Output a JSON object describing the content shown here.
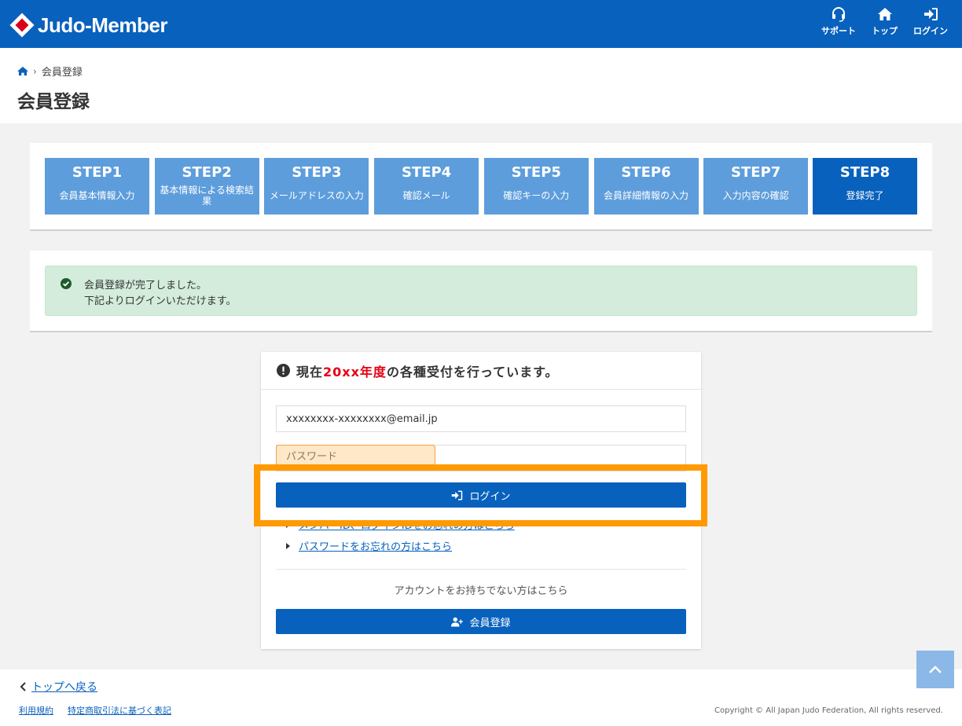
{
  "header": {
    "logo_text": "Judo-Member",
    "nav": [
      {
        "label": "サポート",
        "icon": "headset-icon"
      },
      {
        "label": "トップ",
        "icon": "home-icon"
      },
      {
        "label": "ログイン",
        "icon": "sign-in-icon"
      }
    ]
  },
  "breadcrumb": {
    "home_icon": "home-icon",
    "current": "会員登録"
  },
  "page_title": "会員登録",
  "steps": [
    {
      "num": "STEP1",
      "label": "会員基本情報入力"
    },
    {
      "num": "STEP2",
      "label": "基本情報による検索結果"
    },
    {
      "num": "STEP3",
      "label": "メールアドレスの入力"
    },
    {
      "num": "STEP4",
      "label": "確認メール"
    },
    {
      "num": "STEP5",
      "label": "確認キーの入力"
    },
    {
      "num": "STEP6",
      "label": "会員詳細情報の入力"
    },
    {
      "num": "STEP7",
      "label": "入力内容の確認"
    },
    {
      "num": "STEP8",
      "label": "登録完了"
    }
  ],
  "active_step": "STEP8",
  "success": {
    "line1": "会員登録が完了しました。",
    "line2": "下記よりログインいただけます。"
  },
  "login": {
    "notice_prefix": "現在",
    "notice_year": "20xx年度",
    "notice_suffix": "の各種受付を行っています。",
    "email_value": "xxxxxxxx-xxxxxxxx@email.jp",
    "password_placeholder": "パスワード",
    "login_button": "ログイン",
    "link_forgot_id": "メンバーID、ログインIDをお忘れの方はこちら",
    "link_forgot_password": "パスワードをお忘れの方はこちら",
    "no_account_text": "アカウントをお持ちでない方はこちら",
    "register_button": "会員登録"
  },
  "footer": {
    "back_link": "トップへ戻る",
    "terms": "利用規約",
    "commerce_law": "特定商取引法に基づく表記",
    "copyright": "Copyright © All Japan Judo Federation, All rights reserved."
  },
  "colors": {
    "primary": "#0861bd",
    "step_inactive": "#5d9ddc",
    "success_bg": "#d4ecdb",
    "highlight": "#ff9a00",
    "year_red": "#e60012"
  }
}
